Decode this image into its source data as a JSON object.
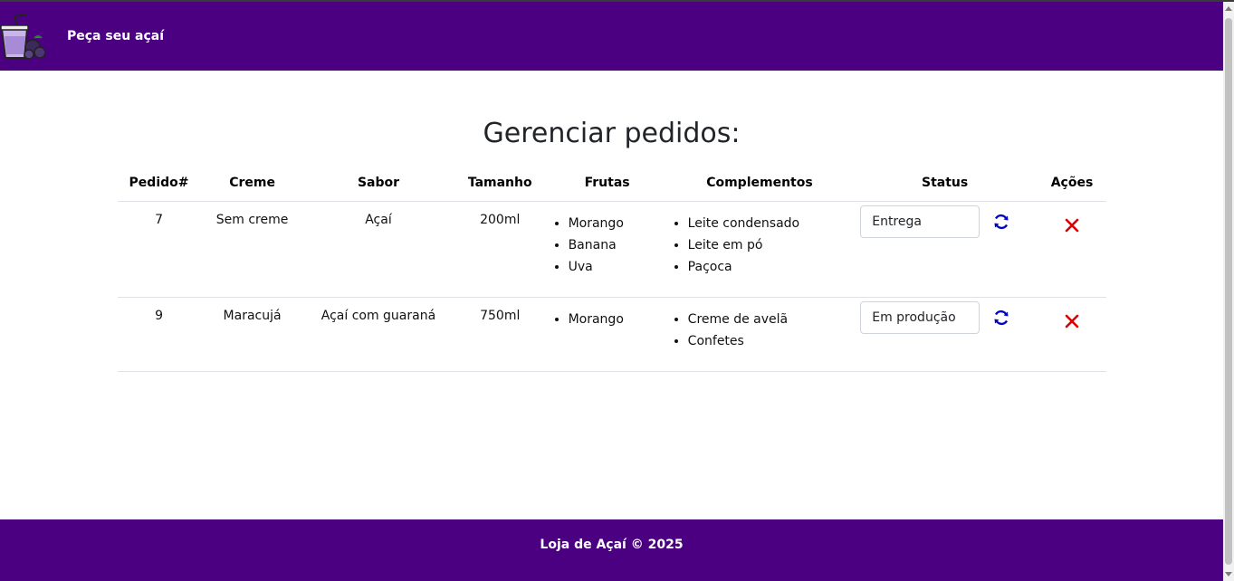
{
  "header": {
    "brand": "Peça seu açaí"
  },
  "main": {
    "title": "Gerenciar pedidos:"
  },
  "table": {
    "columns": [
      "Pedido#",
      "Creme",
      "Sabor",
      "Tamanho",
      "Frutas",
      "Complementos",
      "Status",
      "Ações"
    ],
    "rows": [
      {
        "pedido": "7",
        "creme": "Sem creme",
        "sabor": "Açaí",
        "tamanho": "200ml",
        "frutas": [
          "Morango",
          "Banana",
          "Uva"
        ],
        "complementos": [
          "Leite condensado",
          "Leite em pó",
          "Paçoca"
        ],
        "status": "Entrega"
      },
      {
        "pedido": "9",
        "creme": "Maracujá",
        "sabor": "Açaí com guaraná",
        "tamanho": "750ml",
        "frutas": [
          "Morango"
        ],
        "complementos": [
          "Creme de avelã",
          "Confetes"
        ],
        "status": "Em produção"
      }
    ]
  },
  "footer": {
    "text": "Loja de Açaí © 2025"
  },
  "icons": {
    "logo": "acai-cup-logo-icon",
    "refresh": "refresh-icon",
    "delete": "close-icon"
  },
  "colors": {
    "brand": "#4b0082",
    "refresh": "#0000cc",
    "delete": "#dd0000"
  }
}
